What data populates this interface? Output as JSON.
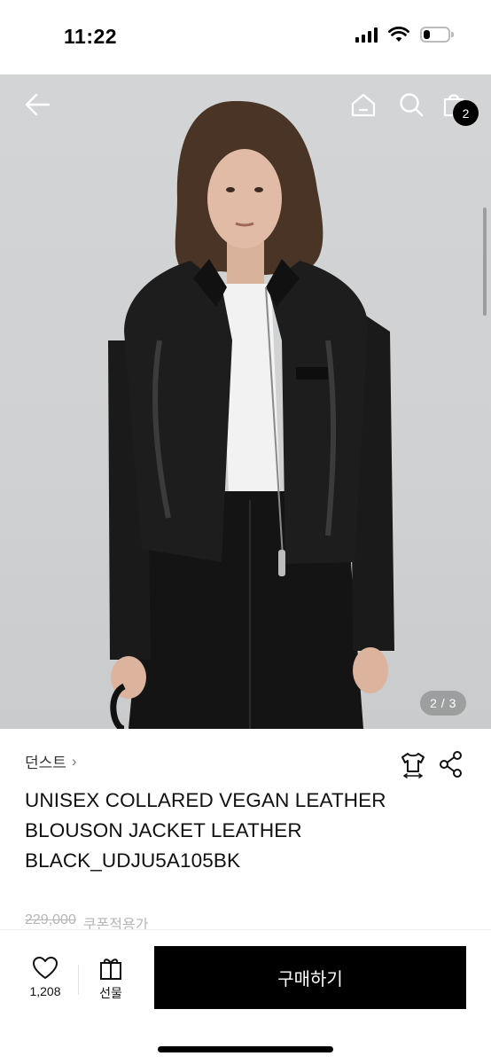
{
  "status_bar": {
    "time": "11:22",
    "battery_level": 0.25
  },
  "top_nav": {
    "back_icon": "arrow-left-icon",
    "home_icon": "home-icon",
    "search_icon": "search-icon",
    "cart_icon": "shopping-bag-icon",
    "cart_count": "2"
  },
  "gallery": {
    "indicator": "2 / 3",
    "current": 2,
    "total": 3
  },
  "product": {
    "brand": "던스트",
    "brand_chevron": "›",
    "size_icon": "tshirt-size-icon",
    "share_icon": "share-icon",
    "title": "UNISEX COLLARED VEGAN LEATHER BLOUSON JACKET LEATHER BLACK_UDJU5A105BK",
    "price_original": "229,000",
    "price_note": "쿠폰적용가"
  },
  "action_bar": {
    "wish_icon": "heart-icon",
    "wish_count": "1,208",
    "gift_icon": "gift-icon",
    "gift_label": "선물",
    "buy_label": "구매하기"
  },
  "colors": {
    "accent": "#000000",
    "muted_text": "#b6b6b6",
    "hero_background": "#d0d2d4"
  }
}
